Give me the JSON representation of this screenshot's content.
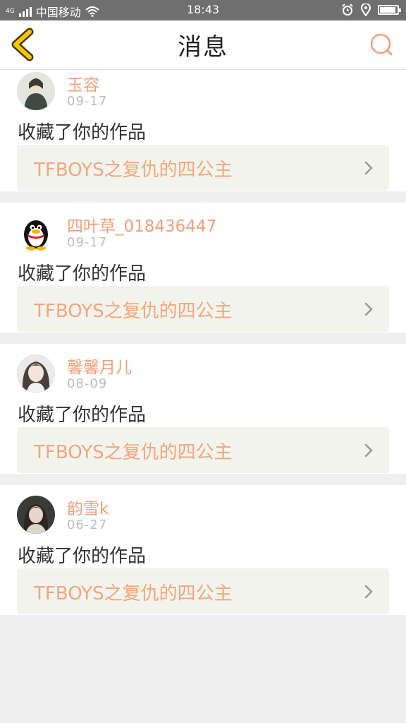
{
  "status_bar": {
    "network_label": "4G",
    "carrier": "中国移动",
    "time": "18:43",
    "battery_level": 0.85
  },
  "header": {
    "title": "消息"
  },
  "notifications": [
    {
      "username": "玉容",
      "date": "09-17",
      "action": "收藏了你的作品",
      "work_title": "TFBOYS之复仇的四公主"
    },
    {
      "username": "四叶草_018436447",
      "date": "09-17",
      "action": "收藏了你的作品",
      "work_title": "TFBOYS之复仇的四公主"
    },
    {
      "username": "馨馨月儿",
      "date": "08-09",
      "action": "收藏了你的作品",
      "work_title": "TFBOYS之复仇的四公主"
    },
    {
      "username": "韵雪k",
      "date": "06-27",
      "action": "收藏了你的作品",
      "work_title": "TFBOYS之复仇的四公主"
    }
  ],
  "icons": {
    "back": "back-chevron-icon",
    "search": "search-icon",
    "chevron": "chevron-right-icon"
  },
  "colors": {
    "accent": "#f0a077",
    "back_icon_fill": "#f5c900"
  }
}
